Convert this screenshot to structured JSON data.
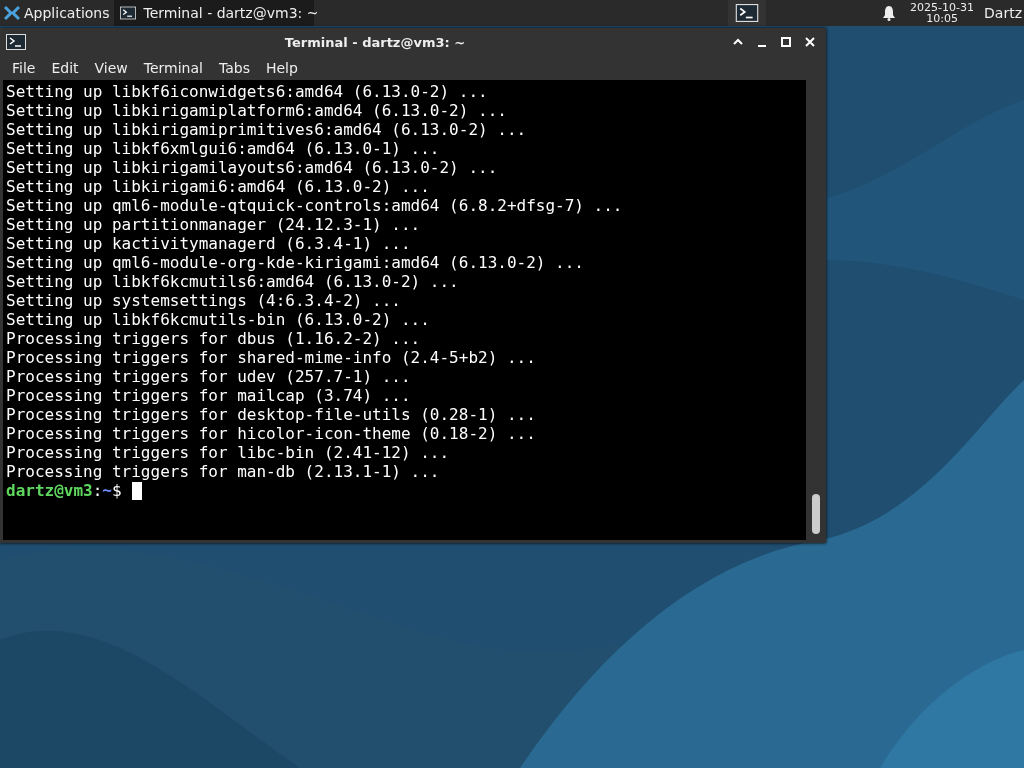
{
  "panel": {
    "menu_label": "Applications",
    "tasks": [
      {
        "label": "Terminal - dartz@vm3: ~",
        "selected": true
      }
    ],
    "clock": {
      "date": "2025-10-31",
      "time": "10:05"
    },
    "user": "Dartz"
  },
  "window": {
    "title": "Terminal - dartz@vm3: ~",
    "menu": [
      "File",
      "Edit",
      "View",
      "Terminal",
      "Tabs",
      "Help"
    ],
    "lines": [
      "Setting up libkf6iconwidgets6:amd64 (6.13.0-2) ...",
      "Setting up libkirigamiplatform6:amd64 (6.13.0-2) ...",
      "Setting up libkirigamiprimitives6:amd64 (6.13.0-2) ...",
      "Setting up libkf6xmlgui6:amd64 (6.13.0-1) ...",
      "Setting up libkirigamilayouts6:amd64 (6.13.0-2) ...",
      "Setting up libkirigami6:amd64 (6.13.0-2) ...",
      "Setting up qml6-module-qtquick-controls:amd64 (6.8.2+dfsg-7) ...",
      "Setting up partitionmanager (24.12.3-1) ...",
      "Setting up kactivitymanagerd (6.3.4-1) ...",
      "Setting up qml6-module-org-kde-kirigami:amd64 (6.13.0-2) ...",
      "Setting up libkf6kcmutils6:amd64 (6.13.0-2) ...",
      "Setting up systemsettings (4:6.3.4-2) ...",
      "Setting up libkf6kcmutils-bin (6.13.0-2) ...",
      "Processing triggers for dbus (1.16.2-2) ...",
      "Processing triggers for shared-mime-info (2.4-5+b2) ...",
      "Processing triggers for udev (257.7-1) ...",
      "Processing triggers for mailcap (3.74) ...",
      "Processing triggers for desktop-file-utils (0.28-1) ...",
      "Processing triggers for hicolor-icon-theme (0.18-2) ...",
      "Processing triggers for libc-bin (2.41-12) ...",
      "Processing triggers for man-db (2.13.1-1) ..."
    ],
    "prompt": {
      "user_host": "dartz@vm3",
      "separator": ":",
      "path": "~",
      "symbol": "$"
    }
  }
}
